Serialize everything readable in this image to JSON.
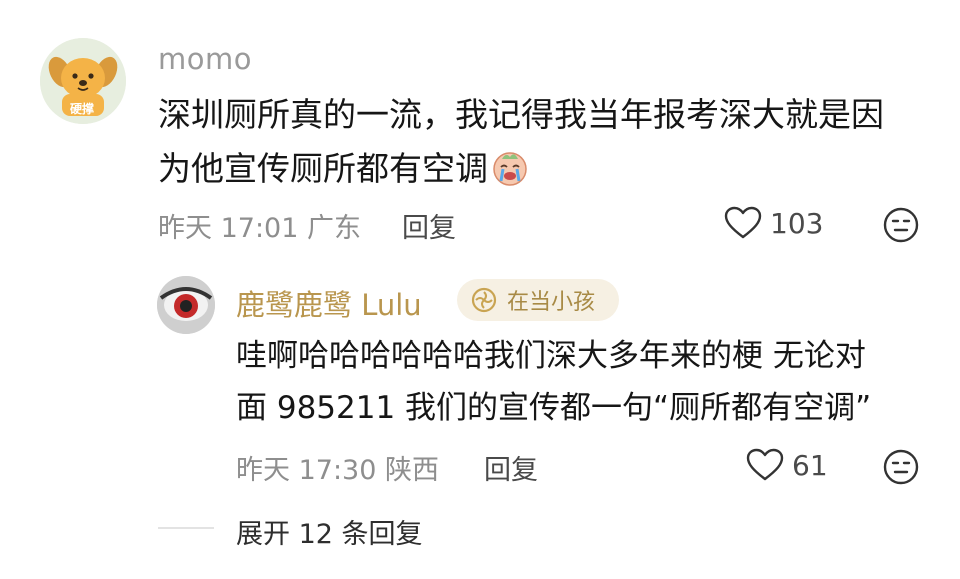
{
  "comment": {
    "username": "momo",
    "avatar_caption": "硬撑",
    "text_line1": "深圳厕所真的一流，我记得我当年报考深大就是因",
    "text_line2": "为他宣传厕所都有空调",
    "emoji": "crying-face-emoji",
    "time": "昨天 17:01",
    "location": "广东",
    "reply_label": "回复",
    "like_count": "103"
  },
  "reply": {
    "username": "鹿鹭鹿鹭 Lulu",
    "badge": "在当小孩",
    "text_line1": "哇啊哈哈哈哈哈哈我们深大多年来的梗 无论对",
    "text_line2": "面 985211 我们的宣传都一句“厕所都有空调”",
    "time": "昨天 17:30",
    "location": "陕西",
    "reply_label": "回复",
    "like_count": "61"
  },
  "expand": {
    "label": "展开 12 条回复"
  },
  "colors": {
    "username_gray": "#9a9a9a",
    "reply_name_gold": "#b9964e",
    "badge_bg": "#f6f0e3"
  }
}
